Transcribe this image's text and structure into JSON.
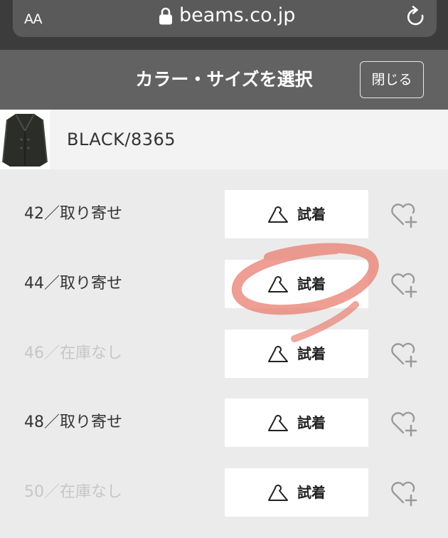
{
  "browser": {
    "text_size_label": "AA",
    "url": "beams.co.jp"
  },
  "modal": {
    "title": "カラー・サイズを選択",
    "close_label": "閉じる"
  },
  "color_option": {
    "name": "BLACK/8365"
  },
  "sizes": [
    {
      "label": "42／取り寄せ",
      "try_on_label": "試着",
      "available": true
    },
    {
      "label": "44／取り寄せ",
      "try_on_label": "試着",
      "available": true
    },
    {
      "label": "46／在庫なし",
      "try_on_label": "試着",
      "available": false
    },
    {
      "label": "48／取り寄せ",
      "try_on_label": "試着",
      "available": true
    },
    {
      "label": "50／在庫なし",
      "try_on_label": "試着",
      "available": false
    }
  ],
  "icons": {
    "lock": "lock-icon",
    "reload": "reload-icon",
    "hanger": "hanger-icon",
    "favorite": "heart-plus-icon"
  },
  "colors": {
    "browser_bar": "#3c3c3c",
    "header": "#626262",
    "background": "#ebebeb",
    "annotation": "#e8786a"
  }
}
